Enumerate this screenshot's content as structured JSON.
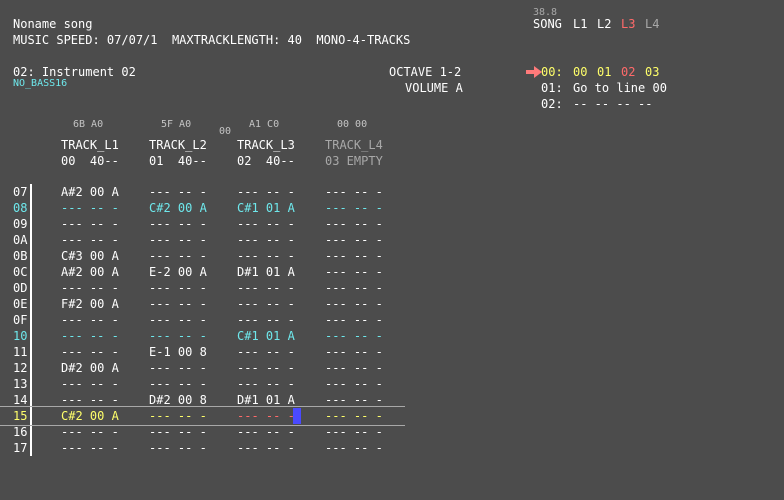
{
  "song_title": "Noname song",
  "info_line": "MUSIC SPEED: 07/07/1  MAXTRACKLENGTH: 40  MONO-4-TRACKS",
  "instrument": {
    "name": "02: Instrument 02",
    "sub": "NO_BASS16"
  },
  "octave": "OCTAVE 1-2",
  "volume": "VOLUME A",
  "song_panel": {
    "value": "38.8",
    "label": "SONG",
    "tabs": [
      "L1",
      "L2",
      "L3",
      "L4"
    ],
    "lines": [
      {
        "num": "00:",
        "text": "00 01 02 03",
        "parts": [
          "00",
          "01",
          "02",
          "03"
        ]
      },
      {
        "num": "01:",
        "text": "Go to line 00"
      },
      {
        "num": "02:",
        "text": "-- -- -- --"
      }
    ]
  },
  "tracks": [
    {
      "hex": "6B A0",
      "name": "TRACK_L1",
      "info": "00  40--"
    },
    {
      "hex": "5F A0",
      "name": "TRACK_L2",
      "info": "01  40--"
    },
    {
      "hex": "A1 C0",
      "name": "TRACK_L3",
      "info": "02  40--"
    },
    {
      "hex": "00 00",
      "name": "TRACK_L4",
      "info": "03 EMPTY"
    }
  ],
  "center_hex": "00",
  "rows": [
    {
      "num": "07",
      "cells": [
        "A#2 00 A",
        "--- -- -",
        "--- -- -",
        "--- -- -"
      ]
    },
    {
      "num": "08",
      "cells": [
        "--- -- -",
        "C#2 00 A",
        "C#1 01 A",
        "--- -- -"
      ]
    },
    {
      "num": "09",
      "cells": [
        "--- -- -",
        "--- -- -",
        "--- -- -",
        "--- -- -"
      ]
    },
    {
      "num": "0A",
      "cells": [
        "--- -- -",
        "--- -- -",
        "--- -- -",
        "--- -- -"
      ]
    },
    {
      "num": "0B",
      "cells": [
        "C#3 00 A",
        "--- -- -",
        "--- -- -",
        "--- -- -"
      ]
    },
    {
      "num": "0C",
      "cells": [
        "A#2 00 A",
        "E-2 00 A",
        "D#1 01 A",
        "--- -- -"
      ]
    },
    {
      "num": "0D",
      "cells": [
        "--- -- -",
        "--- -- -",
        "--- -- -",
        "--- -- -"
      ]
    },
    {
      "num": "0E",
      "cells": [
        "F#2 00 A",
        "--- -- -",
        "--- -- -",
        "--- -- -"
      ]
    },
    {
      "num": "0F",
      "cells": [
        "--- -- -",
        "--- -- -",
        "--- -- -",
        "--- -- -"
      ]
    },
    {
      "num": "10",
      "cells": [
        "--- -- -",
        "--- -- -",
        "C#1 01 A",
        "--- -- -"
      ]
    },
    {
      "num": "11",
      "cells": [
        "--- -- -",
        "E-1 00 8",
        "--- -- -",
        "--- -- -"
      ]
    },
    {
      "num": "12",
      "cells": [
        "D#2 00 A",
        "--- -- -",
        "--- -- -",
        "--- -- -"
      ]
    },
    {
      "num": "13",
      "cells": [
        "--- -- -",
        "--- -- -",
        "--- -- -",
        "--- -- -"
      ]
    },
    {
      "num": "14",
      "cells": [
        "--- -- -",
        "D#2 00 8",
        "D#1 01 A",
        "--- -- -"
      ]
    },
    {
      "num": "15",
      "cells": [
        "C#2 00 A",
        "--- -- -",
        "--- -- -",
        "--- -- -"
      ]
    },
    {
      "num": "16",
      "cells": [
        "--- -- -",
        "--- -- -",
        "--- -- -",
        "--- -- -"
      ]
    },
    {
      "num": "17",
      "cells": [
        "--- -- -",
        "--- -- -",
        "--- -- -",
        "--- -- -"
      ]
    }
  ],
  "colors": {
    "background": "#4c4c4c",
    "highlight": "#6ee8ec",
    "cursor_row": "#ffff6a",
    "active": "#ff6a6a",
    "cursor": "#4a4aff"
  }
}
